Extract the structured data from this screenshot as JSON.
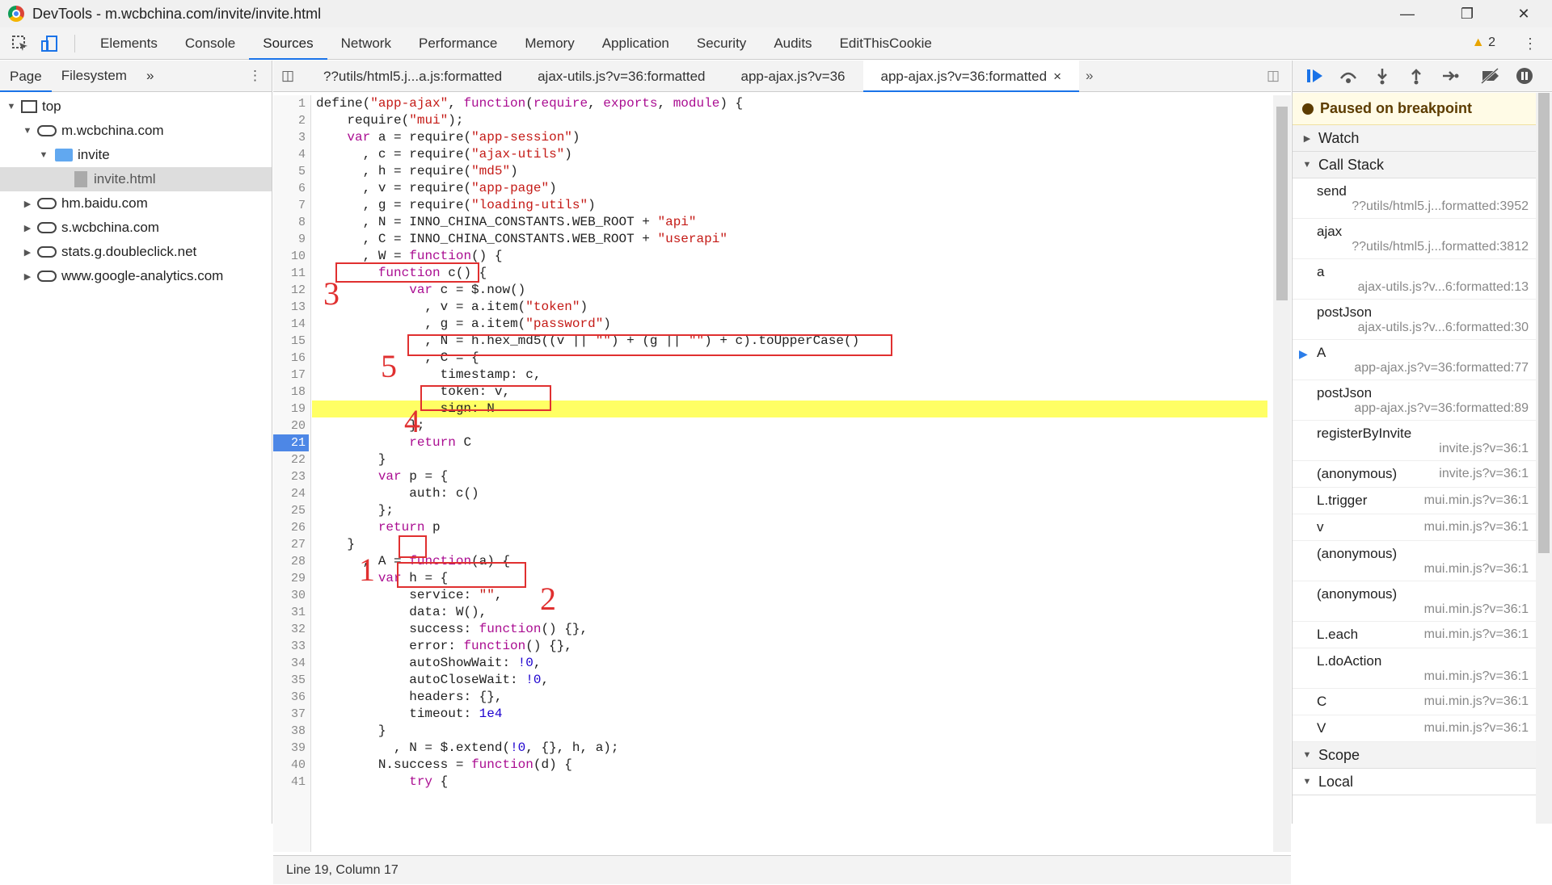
{
  "window": {
    "title": "DevTools - m.wcbchina.com/invite/invite.html"
  },
  "toolbar": {
    "tabs": [
      "Elements",
      "Console",
      "Sources",
      "Network",
      "Performance",
      "Memory",
      "Application",
      "Security",
      "Audits",
      "EditThisCookie"
    ],
    "active_tab": "Sources",
    "warnings": "2"
  },
  "navigator": {
    "tabs": [
      "Page",
      "Filesystem"
    ],
    "more": "»",
    "tree": [
      {
        "label": "top",
        "depth": 0,
        "kind": "frame",
        "expanded": true
      },
      {
        "label": "m.wcbchina.com",
        "depth": 1,
        "kind": "domain",
        "expanded": true
      },
      {
        "label": "invite",
        "depth": 2,
        "kind": "folder",
        "expanded": true
      },
      {
        "label": "invite.html",
        "depth": 3,
        "kind": "file",
        "selected": true
      },
      {
        "label": "hm.baidu.com",
        "depth": 1,
        "kind": "domain",
        "expanded": false
      },
      {
        "label": "s.wcbchina.com",
        "depth": 1,
        "kind": "domain",
        "expanded": false
      },
      {
        "label": "stats.g.doubleclick.net",
        "depth": 1,
        "kind": "domain",
        "expanded": false
      },
      {
        "label": "www.google-analytics.com",
        "depth": 1,
        "kind": "domain",
        "expanded": false
      }
    ]
  },
  "editor": {
    "file_tabs": [
      "??utils/html5.j...a.js:formatted",
      "ajax-utils.js?v=36:formatted",
      "app-ajax.js?v=36",
      "app-ajax.js?v=36:formatted"
    ],
    "active_file_tab": 3,
    "close_glyph": "×",
    "more": "»",
    "breakpoint_line": "21",
    "highlight_line": 19,
    "lines": [
      "define(\"app-ajax\", function(require, exports, module) {",
      "    require(\"mui\");",
      "    var a = require(\"app-session\")",
      "      , c = require(\"ajax-utils\")",
      "      , h = require(\"md5\")",
      "      , v = require(\"app-page\")",
      "      , g = require(\"loading-utils\")",
      "      , N = INNO_CHINA_CONSTANTS.WEB_ROOT + \"api\"",
      "      , C = INNO_CHINA_CONSTANTS.WEB_ROOT + \"userapi\"",
      "      , W = function() {",
      "        function c() {",
      "            var c = $.now()",
      "              , v = a.item(\"token\")",
      "              , g = a.item(\"password\")",
      "              , N = h.hex_md5((v || \"\") + (g || \"\") + c).toUpperCase()",
      "              , C = {",
      "                timestamp: c,",
      "                token: v,",
      "                sign: N",
      "            };",
      "            return C",
      "        }",
      "        var p = {",
      "            auth: c()",
      "        };",
      "        return p",
      "    }",
      "      , A = function(a) {",
      "        var h = {",
      "            service: \"\",",
      "            data: W(),",
      "            success: function() {},",
      "            error: function() {},",
      "            autoShowWait: !0,",
      "            autoCloseWait: !0,",
      "            headers: {},",
      "            timeout: 1e4",
      "        }",
      "          , N = $.extend(!0, {}, h, a);",
      "        N.success = function(d) {",
      "            try {"
    ],
    "status": "Line 19, Column 17",
    "annotations": [
      "1",
      "2",
      "3",
      "4",
      "5"
    ]
  },
  "debugger": {
    "paused_text": "Paused on breakpoint",
    "sections": {
      "watch": "Watch",
      "call_stack": "Call Stack",
      "scope": "Scope",
      "local": "Local"
    },
    "call_stack": [
      {
        "fn": "send",
        "loc": "??utils/html5.j...formatted:3952",
        "two_line": true
      },
      {
        "fn": "ajax",
        "loc": "??utils/html5.j...formatted:3812",
        "two_line": true
      },
      {
        "fn": "a",
        "loc": "ajax-utils.js?v...6:formatted:13",
        "two_line": true
      },
      {
        "fn": "postJson",
        "loc": "ajax-utils.js?v...6:formatted:30",
        "two_line": true
      },
      {
        "fn": "A",
        "loc": "app-ajax.js?v=36:formatted:77",
        "two_line": true,
        "current": true
      },
      {
        "fn": "postJson",
        "loc": "app-ajax.js?v=36:formatted:89",
        "two_line": true
      },
      {
        "fn": "registerByInvite",
        "loc": "invite.js?v=36:1",
        "two_line": true
      },
      {
        "fn": "(anonymous)",
        "loc": "invite.js?v=36:1",
        "two_line": false
      },
      {
        "fn": "L.trigger",
        "loc": "mui.min.js?v=36:1",
        "two_line": false
      },
      {
        "fn": "v",
        "loc": "mui.min.js?v=36:1",
        "two_line": false
      },
      {
        "fn": "(anonymous)",
        "loc": "mui.min.js?v=36:1",
        "two_line": true
      },
      {
        "fn": "(anonymous)",
        "loc": "mui.min.js?v=36:1",
        "two_line": true
      },
      {
        "fn": "L.each",
        "loc": "mui.min.js?v=36:1",
        "two_line": false
      },
      {
        "fn": "L.doAction",
        "loc": "mui.min.js?v=36:1",
        "two_line": true
      },
      {
        "fn": "C",
        "loc": "mui.min.js?v=36:1",
        "two_line": false
      },
      {
        "fn": "V",
        "loc": "mui.min.js?v=36:1",
        "two_line": false
      }
    ]
  },
  "colors": {
    "accent": "#1a73e8",
    "highlight": "#ffff64",
    "annotation": "#e03030",
    "breakpoint": "#4d87e6"
  }
}
